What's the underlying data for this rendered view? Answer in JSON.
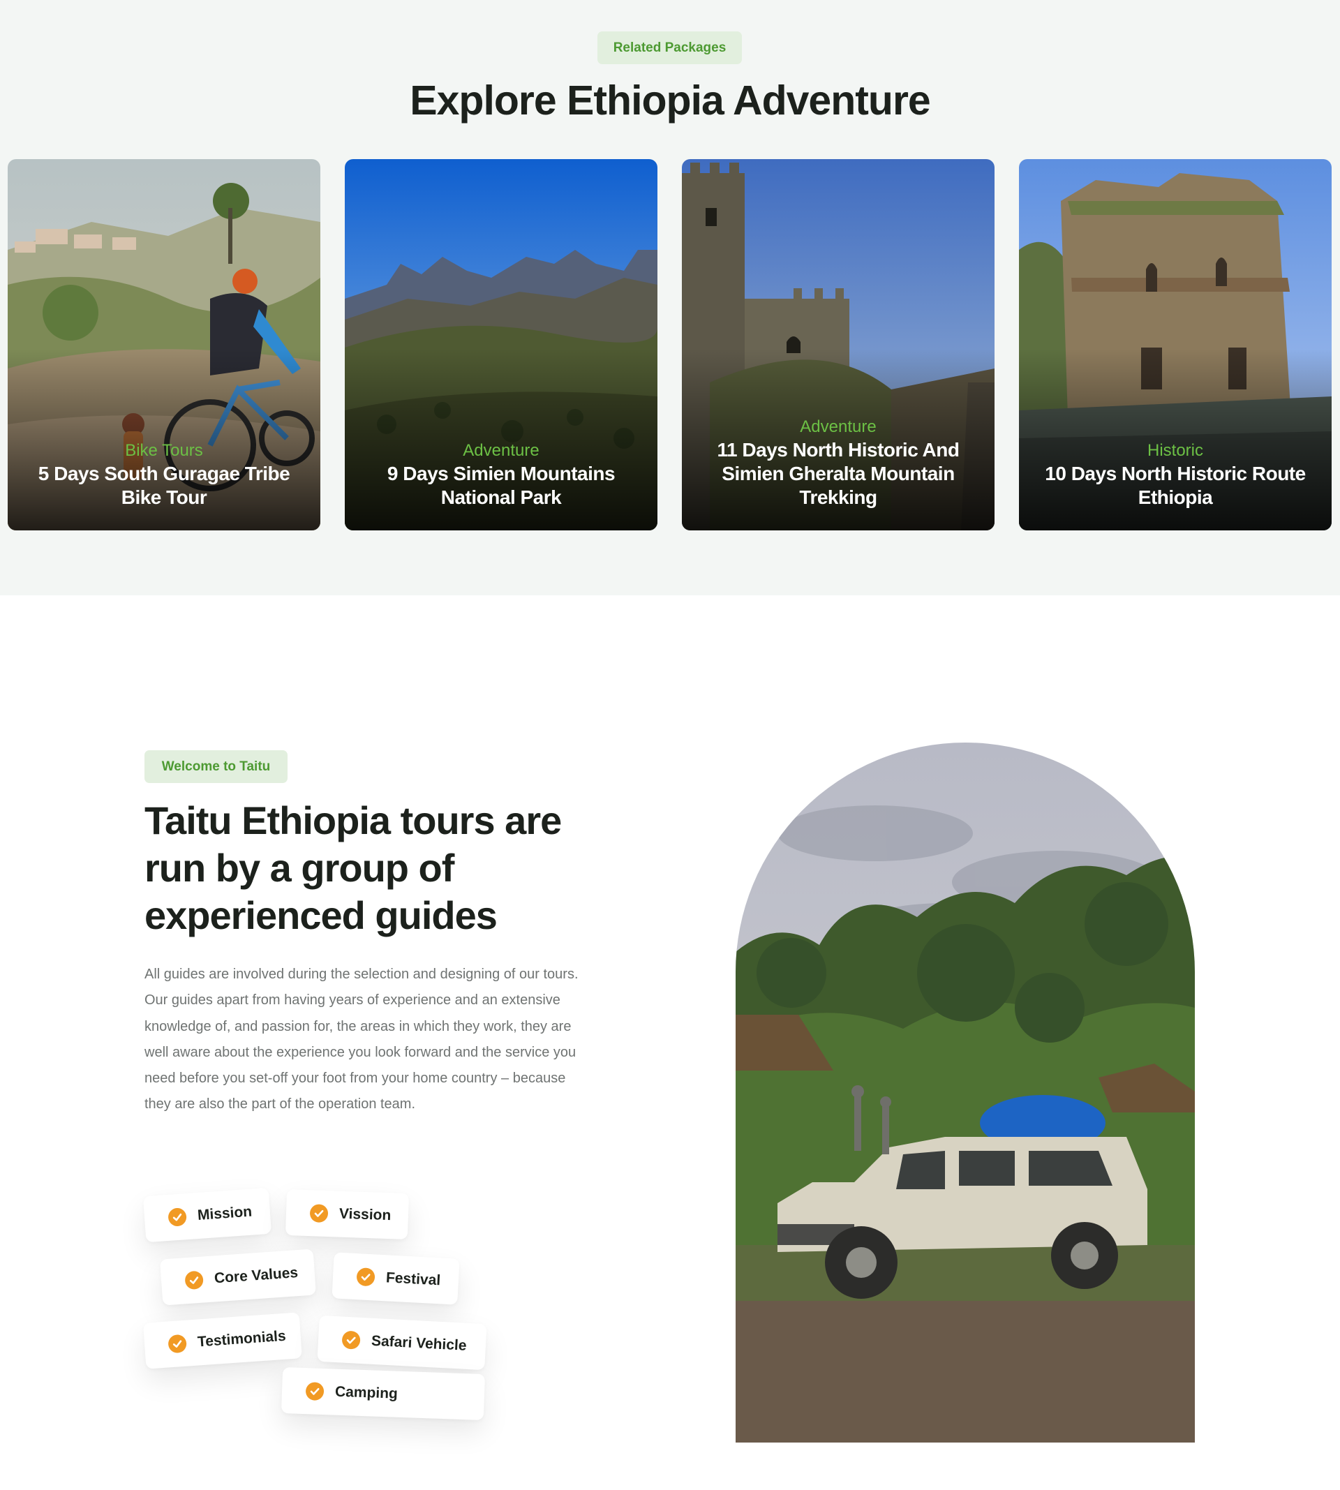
{
  "related": {
    "badge": "Related Packages",
    "title": "Explore Ethiopia Adventure",
    "packages": [
      {
        "category": "Bike Tours",
        "title": "5 Days South Guragae Tribe Bike Tour"
      },
      {
        "category": "Adventure",
        "title": "9 Days Simien Mountains National Park"
      },
      {
        "category": "Adventure",
        "title": "11 Days North Historic And Simien Gheralta Mountain Trekking"
      },
      {
        "category": "Historic",
        "title": "10 Days North Historic Route Ethiopia"
      }
    ]
  },
  "about": {
    "badge": "Welcome to Taitu",
    "title": "Taitu Ethiopia tours are run by a group of experienced guides",
    "text": "All guides are involved during the selection and designing of our tours. Our guides apart from having years of experience and an extensive knowledge of, and passion for, the areas in which they work, they are well aware about the experience you look forward and the service you need before you set-off your foot from your home country – because they are also the part of the operation team.",
    "tags": [
      "Mission",
      "Vission",
      "Core Values",
      "Festival",
      "Testimonials",
      "Safari Vehicle",
      "Camping"
    ]
  },
  "colors": {
    "accent_green": "#6cc045",
    "badge_bg": "#e2efde",
    "check_orange": "#f19a24",
    "heading": "#1c211c"
  },
  "icons": {
    "tag_icon": "check-circle-icon"
  }
}
